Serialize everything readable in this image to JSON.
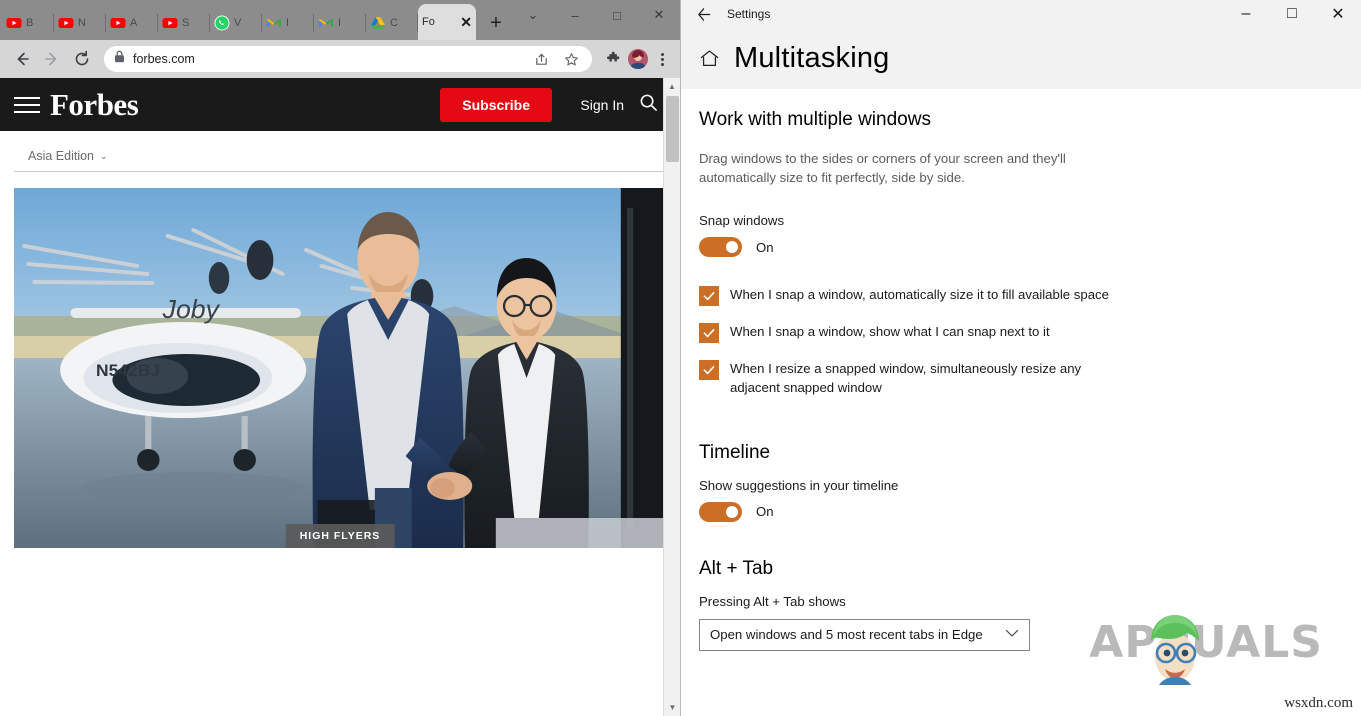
{
  "browser": {
    "window_controls": {
      "minimize": "–",
      "maximize": "□",
      "close": "✕",
      "tablist_caret": "⌄"
    },
    "tabs": [
      {
        "title": "B",
        "favicon": "youtube-icon",
        "active": false
      },
      {
        "title": "N",
        "favicon": "youtube-icon",
        "active": false
      },
      {
        "title": "A",
        "favicon": "youtube-icon",
        "active": false
      },
      {
        "title": "S",
        "favicon": "youtube-icon",
        "active": false
      },
      {
        "title": "V",
        "favicon": "whatsapp-icon",
        "active": false
      },
      {
        "title": "I",
        "favicon": "gmail-icon",
        "active": false
      },
      {
        "title": "I",
        "favicon": "gmail-icon",
        "active": false
      },
      {
        "title": "C",
        "favicon": "google-drive-icon",
        "active": false
      },
      {
        "title": "Fo",
        "favicon": "forbes-icon",
        "active": true
      }
    ],
    "new_tab_label": "+",
    "close_tab_label": "✕",
    "nav": {
      "back": "←",
      "forward": "→",
      "reload": "↻"
    },
    "address": {
      "value": "forbes.com",
      "lock_icon": "lock-icon"
    },
    "omnibox_actions": {
      "share": "share-icon",
      "bookmark": "star-icon",
      "extensions": "puzzle-icon",
      "profile": "avatar",
      "menu": "three-dot-menu-icon"
    }
  },
  "forbes": {
    "logo": "Forbes",
    "menu_icon": "hamburger-menu-icon",
    "subscribe_label": "Subscribe",
    "signin_label": "Sign In",
    "search_icon": "search-icon",
    "edition": {
      "label": "Asia Edition",
      "caret": "⌄"
    },
    "hero": {
      "caption": "HIGH FLYERS",
      "alt": "Two men shaking hands in front of a white Joby electric aircraft inside a hangar",
      "aircraft_name": "Joby",
      "tail_number": "N542BJ"
    },
    "scrollbar": {
      "up": "▲",
      "down": "▼"
    }
  },
  "settings": {
    "titlebar": {
      "back_icon": "back-arrow-icon",
      "title": "Settings",
      "minimize": "–",
      "maximize": "□",
      "close": "✕"
    },
    "home_icon": "home-icon",
    "page_title": "Multitasking",
    "sections": [
      {
        "heading": "Work with multiple windows",
        "description": "Drag windows to the sides or corners of your screen and they'll automatically size to fit perfectly, side by side.",
        "setting_label": "Snap windows",
        "toggle": {
          "state": "On",
          "enabled": true
        },
        "checkboxes": [
          {
            "label": "When I snap a window, automatically size it to fill available space",
            "checked": true
          },
          {
            "label": "When I snap a window, show what I can snap next to it",
            "checked": true
          },
          {
            "label": "When I resize a snapped window, simultaneously resize any adjacent snapped window",
            "checked": true
          }
        ]
      },
      {
        "heading": "Timeline",
        "setting_label": "Show suggestions in your timeline",
        "toggle": {
          "state": "On",
          "enabled": true
        }
      },
      {
        "heading": "Alt + Tab",
        "setting_label": "Pressing Alt + Tab shows",
        "dropdown": {
          "value": "Open windows and 5 most recent tabs in Edge",
          "caret": "⌄"
        }
      }
    ]
  },
  "watermark": {
    "brand": "APPUALS",
    "brand_prefix": "A",
    "brand_suffix": "PUALS",
    "source": "wsxdn.com"
  },
  "colors": {
    "accent_orange": "#cc6f26",
    "forbes_red": "#e50914",
    "forbes_black": "#1a1a1a",
    "settings_header_bg": "#f2f2f2",
    "tabstrip_bg": "#8c8c8c",
    "omnibar_bg": "#d6d6d6"
  }
}
